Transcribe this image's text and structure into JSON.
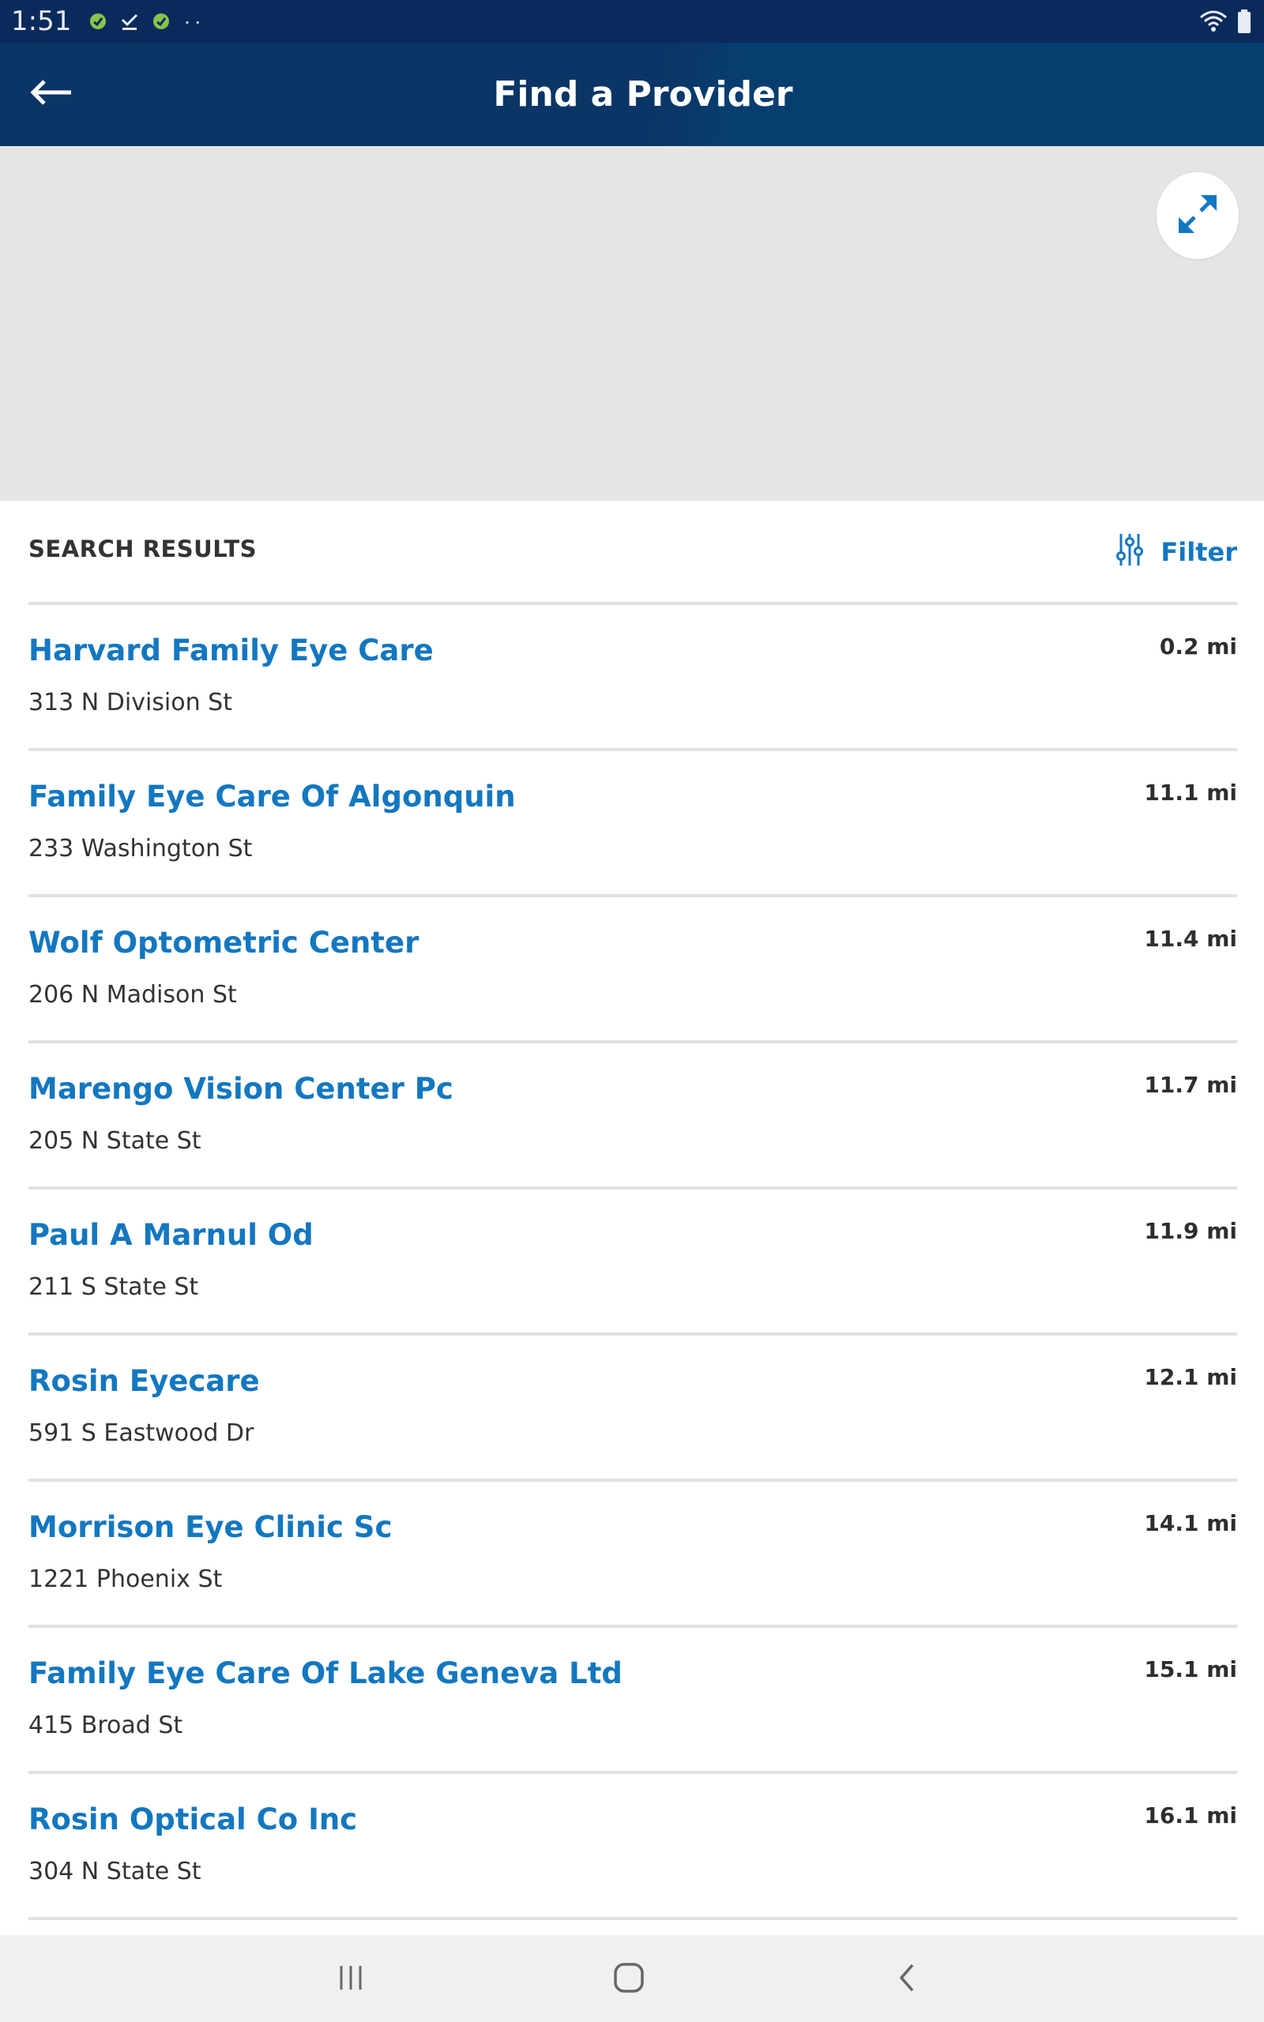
{
  "status_bar": {
    "time": "1:51",
    "icons": [
      "vpn-leaf-icon",
      "download-done-icon",
      "vpn-leaf-icon"
    ],
    "more": "··",
    "right_icons": [
      "wifi-icon",
      "battery-icon"
    ]
  },
  "header": {
    "title": "Find a Provider",
    "back_icon": "arrow-left-icon",
    "bg_color": "#0b3566"
  },
  "map": {
    "expand_icon": "expand-arrows-icon",
    "bg_color": "#e6e5e3"
  },
  "results": {
    "title": "SEARCH RESULTS",
    "filter_label": "Filter",
    "filter_icon": "sliders-icon",
    "accent_color": "#1377c0",
    "items": [
      {
        "name": "Harvard Family Eye Care",
        "address": "313 N Division St",
        "distance": "0.2 mi"
      },
      {
        "name": "Family Eye Care Of Algonquin",
        "address": "233 Washington St",
        "distance": "11.1 mi"
      },
      {
        "name": "Wolf Optometric Center",
        "address": "206 N Madison St",
        "distance": "11.4 mi"
      },
      {
        "name": "Marengo Vision Center Pc",
        "address": "205 N State St",
        "distance": "11.7 mi"
      },
      {
        "name": "Paul A Marnul Od",
        "address": "211 S State St",
        "distance": "11.9 mi"
      },
      {
        "name": "Rosin Eyecare",
        "address": "591 S Eastwood Dr",
        "distance": "12.1 mi"
      },
      {
        "name": "Morrison Eye Clinic Sc",
        "address": "1221 Phoenix St",
        "distance": "14.1 mi"
      },
      {
        "name": "Family Eye Care Of Lake Geneva Ltd",
        "address": "415 Broad St",
        "distance": "15.1 mi"
      },
      {
        "name": "Rosin Optical Co Inc",
        "address": "304 N State St",
        "distance": "16.1 mi"
      }
    ]
  },
  "nav_bar": {
    "icons": [
      "recent-apps-icon",
      "home-icon",
      "back-chevron-icon"
    ]
  }
}
